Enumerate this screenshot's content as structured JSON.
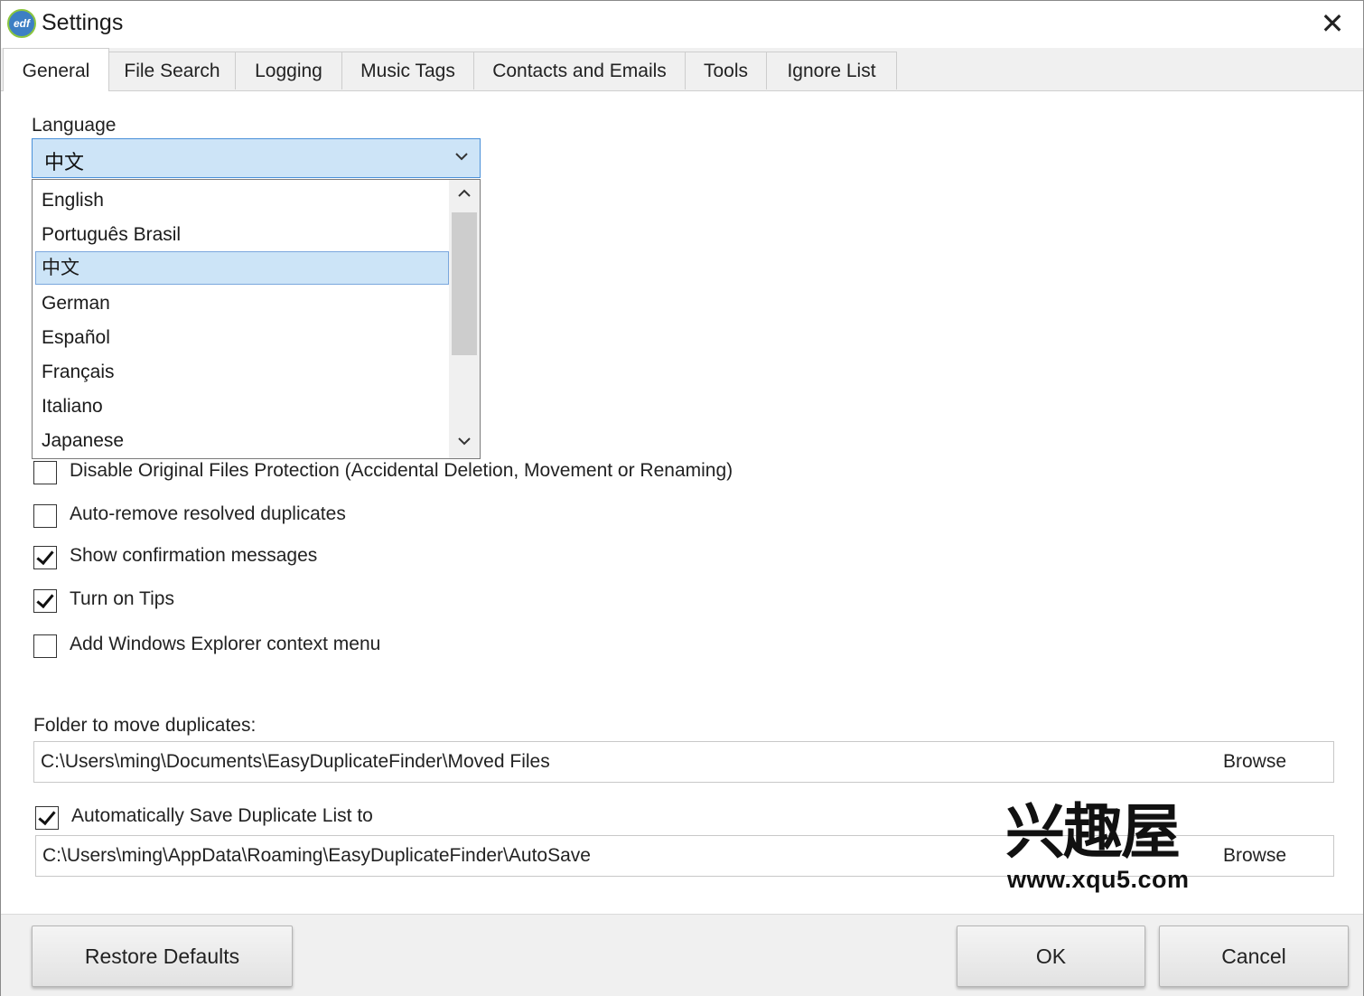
{
  "window": {
    "title": "Settings",
    "app_icon": "edf-logo-icon",
    "close_glyph": "✕",
    "app_icon_text": "edf"
  },
  "tabs": [
    {
      "label": "General",
      "active": true
    },
    {
      "label": "File Search"
    },
    {
      "label": "Logging"
    },
    {
      "label": "Music Tags"
    },
    {
      "label": "Contacts and Emails"
    },
    {
      "label": "Tools"
    },
    {
      "label": "Ignore List"
    }
  ],
  "language": {
    "label": "Language",
    "selected": "中文",
    "options": [
      "English",
      "Português Brasil",
      "中文",
      "German",
      "Español",
      "Français",
      "Italiano",
      "Japanese"
    ],
    "selected_index": 2
  },
  "checkboxes": [
    {
      "label": "Disable Original Files Protection (Accidental Deletion, Movement or Renaming)",
      "checked": false
    },
    {
      "label": "Auto-remove resolved duplicates",
      "checked": false
    },
    {
      "label": "Show confirmation messages",
      "checked": true
    },
    {
      "label": "Turn on Tips",
      "checked": true
    },
    {
      "label": "Add Windows Explorer context menu",
      "checked": false
    }
  ],
  "move_folder": {
    "label": "Folder to move duplicates:",
    "path": "C:\\Users\\ming\\Documents\\EasyDuplicateFinder\\Moved Files",
    "browse_label": "Browse"
  },
  "autosave": {
    "label": "Automatically Save Duplicate List to",
    "checked": true,
    "path": "C:\\Users\\ming\\AppData\\Roaming\\EasyDuplicateFinder\\AutoSave",
    "browse_label": "Browse"
  },
  "footer": {
    "restore_label": "Restore Defaults",
    "ok_label": "OK",
    "cancel_label": "Cancel"
  },
  "watermark": {
    "text_cn": "兴趣屋",
    "url": "www.xqu5.com"
  }
}
